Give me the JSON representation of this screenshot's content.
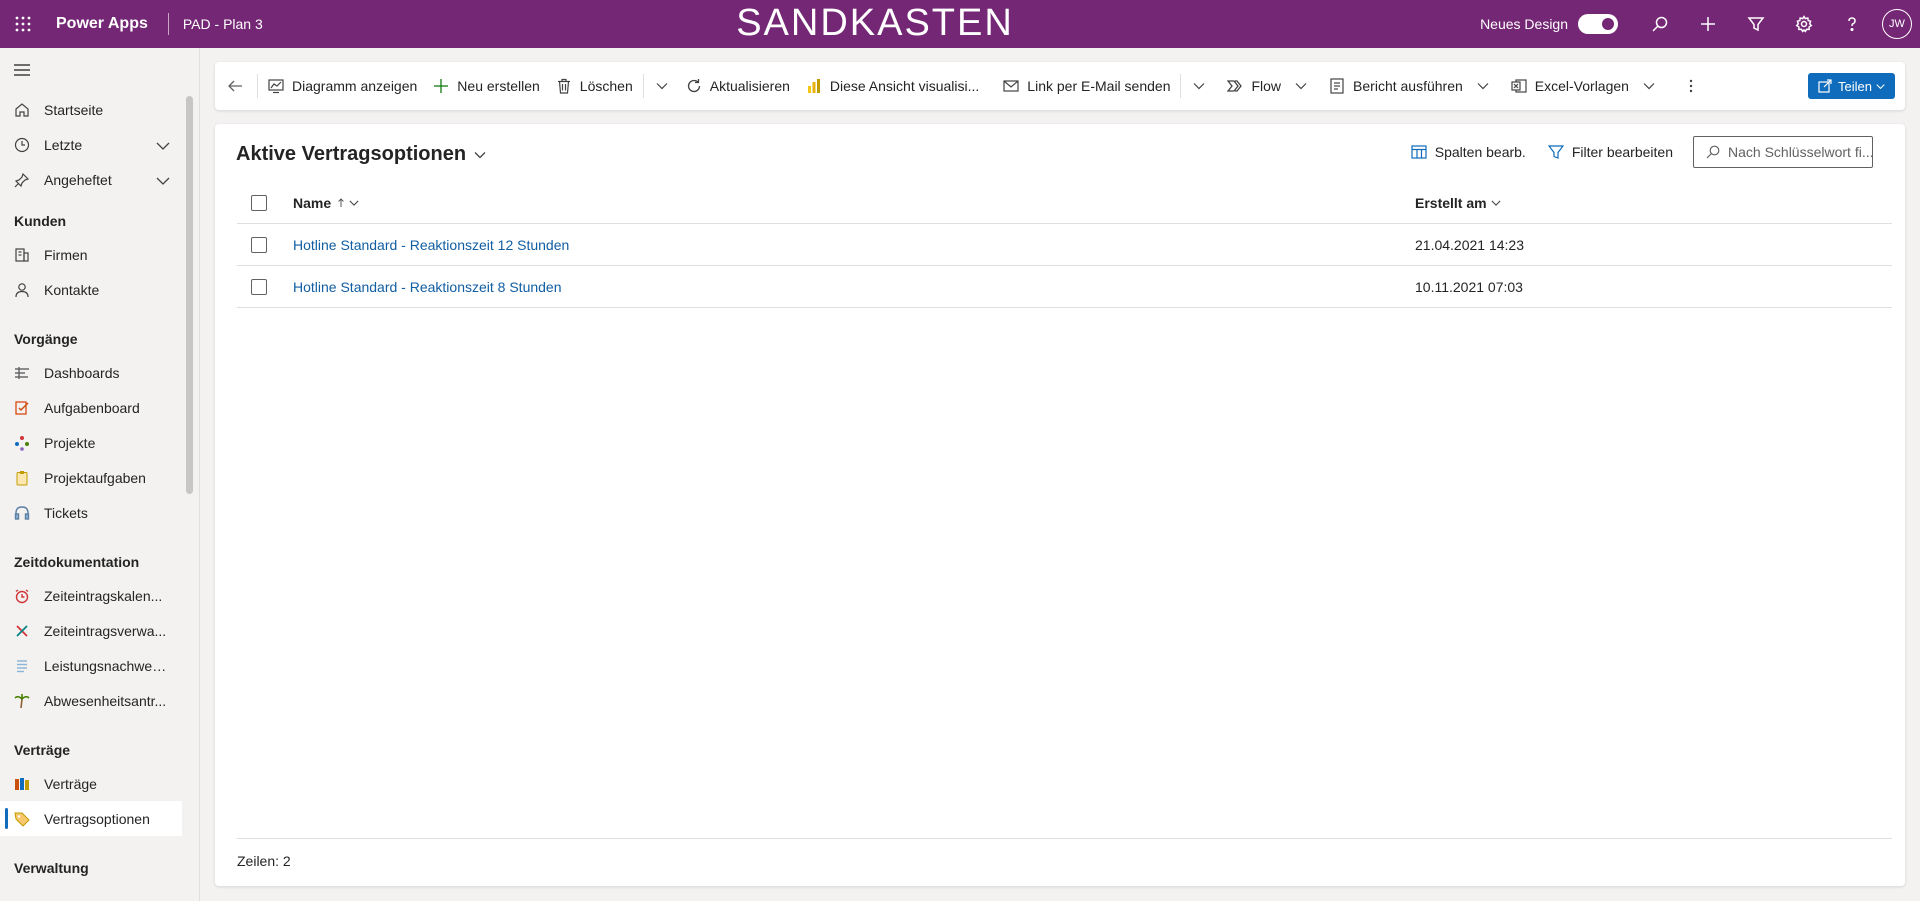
{
  "topbar": {
    "brand": "Power Apps",
    "app_name": "PAD - Plan 3",
    "environment": "SANDKASTEN",
    "new_design_label": "Neues Design",
    "new_design_on": true,
    "avatar_initials": "JW",
    "bg_color": "#742774"
  },
  "sidebar": {
    "top_items": [
      {
        "label": "Startseite",
        "icon": "home-icon"
      },
      {
        "label": "Letzte",
        "icon": "clock-icon",
        "expandable": true
      },
      {
        "label": "Angeheftet",
        "icon": "pin-icon",
        "expandable": true
      }
    ],
    "groups": [
      {
        "title": "Kunden",
        "items": [
          {
            "label": "Firmen",
            "icon": "building-icon"
          },
          {
            "label": "Kontakte",
            "icon": "person-icon"
          }
        ]
      },
      {
        "title": "Vorgänge",
        "items": [
          {
            "label": "Dashboards",
            "icon": "dashboard-icon"
          },
          {
            "label": "Aufgabenboard",
            "icon": "taskboard-icon"
          },
          {
            "label": "Projekte",
            "icon": "projects-icon"
          },
          {
            "label": "Projektaufgaben",
            "icon": "clipboard-icon"
          },
          {
            "label": "Tickets",
            "icon": "headset-icon"
          }
        ]
      },
      {
        "title": "Zeitdokumentation",
        "items": [
          {
            "label": "Zeiteintragskalen...",
            "icon": "alarm-clock-icon"
          },
          {
            "label": "Zeiteintragsverwa...",
            "icon": "tools-icon"
          },
          {
            "label": "Leistungsnachweise",
            "icon": "list-icon"
          },
          {
            "label": "Abwesenheitsantr...",
            "icon": "palm-tree-icon"
          }
        ]
      },
      {
        "title": "Verträge",
        "items": [
          {
            "label": "Verträge",
            "icon": "folders-icon"
          },
          {
            "label": "Vertragsoptionen",
            "icon": "tag-icon",
            "active": true
          }
        ]
      },
      {
        "title": "Verwaltung",
        "items": []
      }
    ]
  },
  "commandbar": {
    "diagram": "Diagramm anzeigen",
    "new": "Neu erstellen",
    "delete": "Löschen",
    "refresh": "Aktualisieren",
    "visualize": "Diese Ansicht visualisi...",
    "email_link": "Link per E-Mail senden",
    "flow": "Flow",
    "report": "Bericht ausführen",
    "excel": "Excel-Vorlagen",
    "share": "Teilen",
    "accent": "#0f6cbd"
  },
  "view": {
    "title": "Aktive Vertragsoptionen",
    "edit_columns": "Spalten bearb.",
    "edit_filters": "Filter bearbeiten",
    "search_placeholder": "Nach Schlüsselwort fi...",
    "columns": {
      "name": "Name",
      "created": "Erstellt am"
    },
    "rows": [
      {
        "name": "Hotline Standard - Reaktionszeit 12 Stunden",
        "created": "21.04.2021 14:23"
      },
      {
        "name": "Hotline Standard - Reaktionszeit 8 Stunden",
        "created": "10.11.2021 07:03"
      }
    ],
    "row_count_label": "Zeilen: 2"
  }
}
